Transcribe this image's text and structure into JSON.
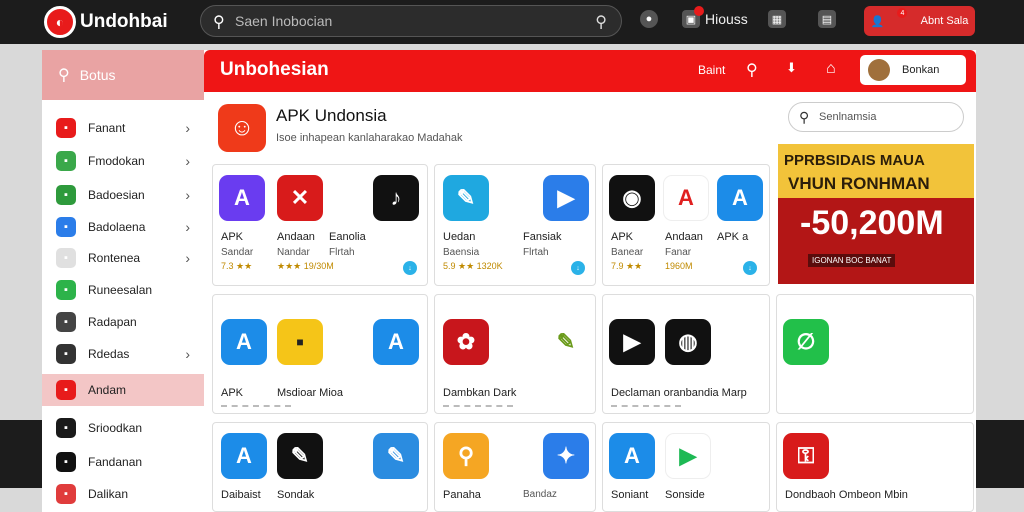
{
  "topbar": {
    "logo_text": "Undohbai",
    "search_placeholder": "Saen Inobocian",
    "icon1_label": "Hiouss",
    "login_label": "Abnt Sala",
    "badge_count": "4"
  },
  "sidebar": {
    "search_label": "Botus",
    "items": [
      {
        "label": "Fanant",
        "icon": "app-icon",
        "color": "#e81b1b",
        "chevron": true
      },
      {
        "label": "Fmodokan",
        "icon": "play-icon",
        "color": "#3aa84a",
        "chevron": true
      },
      {
        "label": "Badoesian",
        "icon": "store-icon",
        "color": "#2e9a3c",
        "chevron": true
      },
      {
        "label": "Badolaena",
        "icon": "a-icon",
        "color": "#2b7de9",
        "chevron": true
      },
      {
        "label": "Rontenea",
        "icon": "a-icon",
        "color": "#e0e0e0",
        "chevron": true
      },
      {
        "label": "Runeesalan",
        "icon": "tool-icon",
        "color": "#2db34a",
        "chevron": false
      },
      {
        "label": "Radapan",
        "icon": "grid-icon",
        "color": "#444",
        "chevron": false
      },
      {
        "label": "Rdedas",
        "icon": "circle-icon",
        "color": "#333",
        "chevron": true
      },
      {
        "label": "Andam",
        "icon": "app-icon",
        "color": "#e81b1b",
        "chevron": false
      },
      {
        "label": "Srioodkan",
        "icon": "box-icon",
        "color": "#1a1a1a",
        "chevron": false
      },
      {
        "label": "Fandanan",
        "icon": "tiktok-icon",
        "color": "#111",
        "chevron": false
      },
      {
        "label": "Dalikan",
        "icon": "play-icon",
        "color": "#e03c3c",
        "chevron": false
      }
    ]
  },
  "main": {
    "title": "Unbohesian",
    "header_link": "Baint",
    "user_label": "Bonkan",
    "featured_title": "APK Undonsia",
    "featured_sub": "Isoe inhapean kanlaharakao Madahak",
    "row1": [
      {
        "apps": [
          {
            "label": "APK",
            "sub": "Sandar",
            "rating": "7.3 ★★"
          },
          {
            "label": "Andaan",
            "sub": "Nandar",
            "rating": "★★★ 19/30M"
          }
        ],
        "extra": {
          "label": "Eanolia",
          "sub": "Flrtah"
        },
        "colors": [
          "#6a3cf0",
          "#d81b1b",
          "#111"
        ]
      },
      {
        "apps": [
          {
            "label": "Uedan",
            "sub": "Baensia",
            "rating": "5.9 ★★ 1320K"
          }
        ],
        "extra": {
          "label": "Fansiak",
          "sub": "Flrtah"
        },
        "colors": [
          "#1fa8e0",
          "#2b7de9"
        ]
      },
      {
        "apps": [
          {
            "label": "APK",
            "sub": "Banear",
            "rating": "7.9 ★★"
          },
          {
            "label": "Andaan",
            "sub": "Fanar",
            "rating": "1960M"
          }
        ],
        "extra": {
          "label": "APK a",
          "sub": ""
        },
        "colors": [
          "#111",
          "#e02020",
          "#1c8ce8"
        ]
      }
    ],
    "row2": [
      {
        "label": "APK",
        "sub": "Msdioar Mioa"
      },
      {
        "label": "Dambkan Dark",
        "sub": ""
      },
      {
        "label": "Declaman oranbandia Marp",
        "sub": ""
      },
      {
        "label": "",
        "sub": ""
      }
    ],
    "row3": [
      {
        "label": "Daibaist",
        "sub": "Sondak"
      },
      {
        "label": "Panaha",
        "sub": "Bandaz"
      },
      {
        "label": "Soniant",
        "sub": "Sonside"
      },
      {
        "label": "Dondbaoh Ombeon Mbin",
        "sub": ""
      }
    ]
  },
  "right_panel": {
    "search_placeholder": "Senlnamsia",
    "banner_line1": "PPRBSIDAIS MAUA",
    "banner_line2": "VHUN RONHMAN",
    "banner_big": "-50,200M",
    "banner_small": "IGONAN BOC BANAT"
  }
}
